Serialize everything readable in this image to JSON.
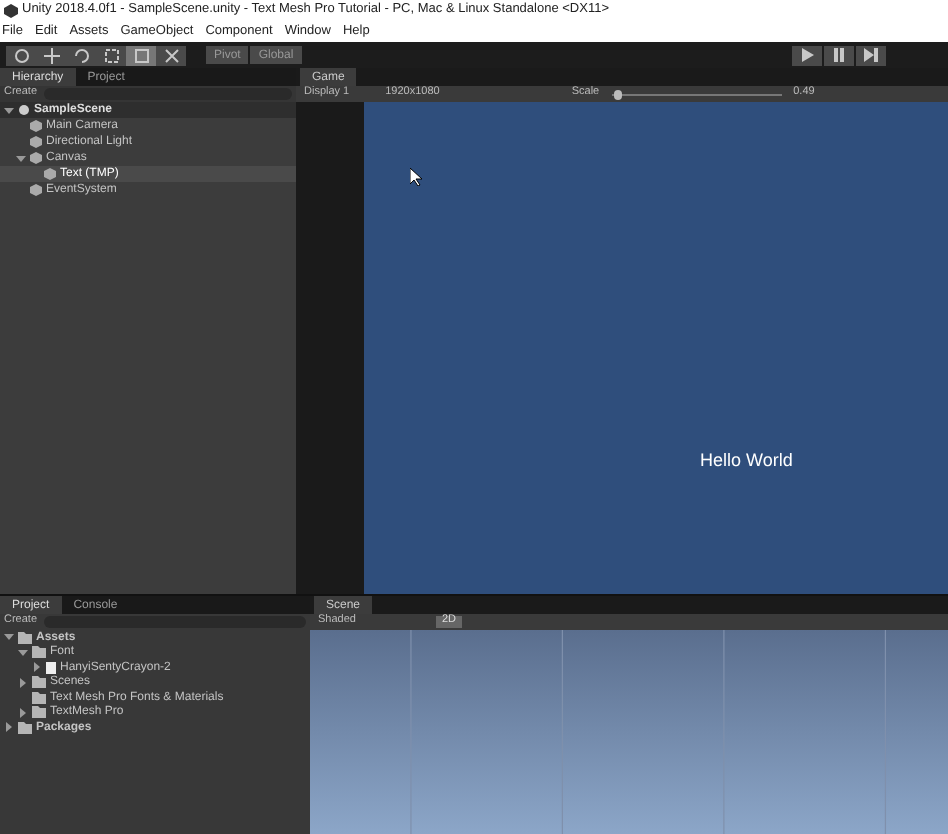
{
  "window": {
    "title": "Unity 2018.4.0f1 - SampleScene.unity - Text Mesh Pro Tutorial - PC, Mac & Linux Standalone <DX11>"
  },
  "menu": [
    "File",
    "Edit",
    "Assets",
    "GameObject",
    "Component",
    "Window",
    "Help"
  ],
  "toolbar": {
    "tools": [
      {
        "kind": "hand",
        "selected": false
      },
      {
        "kind": "move",
        "selected": false
      },
      {
        "kind": "rotate",
        "selected": false
      },
      {
        "kind": "scale",
        "selected": false
      },
      {
        "kind": "rect",
        "selected": true
      },
      {
        "kind": "transform",
        "selected": false
      }
    ],
    "pivot": "Pivot",
    "global": "Global",
    "play": [
      {
        "kind": "play"
      },
      {
        "kind": "pause"
      },
      {
        "kind": "step"
      }
    ]
  },
  "hierarchy": {
    "tabs": [
      {
        "label": "Hierarchy",
        "selected": true
      },
      {
        "label": "Project",
        "selected": false
      }
    ],
    "create": "Create",
    "scene": "SampleScene",
    "items": [
      {
        "label": "Main Camera",
        "selected": false
      },
      {
        "label": "Directional Light",
        "selected": false
      },
      {
        "label": "Canvas",
        "selected": false,
        "expanded": true,
        "children": [
          {
            "label": "Text (TMP)",
            "selected": true
          }
        ]
      },
      {
        "label": "EventSystem",
        "selected": false
      }
    ]
  },
  "game": {
    "tab": "Game",
    "display": "Display 1",
    "resolution": "1920x1080",
    "scale_label": "Scale",
    "scale": {
      "level": 0.02
    },
    "scale_value": "0.49",
    "text": "Hello World"
  },
  "project": {
    "tabs": [
      {
        "label": "Project",
        "selected": true
      },
      {
        "label": "Console",
        "selected": false
      }
    ],
    "create": "Create",
    "items": [
      {
        "label": "Assets",
        "kind": "folder",
        "bold": true,
        "expanded": true,
        "children": [
          {
            "label": "Font",
            "kind": "folder",
            "expanded": true,
            "children": [
              {
                "label": "HanyiSentyCrayon-2",
                "kind": "file",
                "expanded": false
              }
            ]
          },
          {
            "label": "Scenes",
            "kind": "folder",
            "expanded": false
          },
          {
            "label": "Text Mesh Pro Fonts & Materials",
            "kind": "folder"
          },
          {
            "label": "TextMesh Pro",
            "kind": "folder",
            "expanded": false
          }
        ]
      },
      {
        "label": "Packages",
        "kind": "folder",
        "bold": true,
        "expanded": false
      }
    ]
  },
  "scene": {
    "tab": "Scene",
    "shading": "Shaded",
    "mode_2d": {
      "label": "2D",
      "on": true
    }
  }
}
